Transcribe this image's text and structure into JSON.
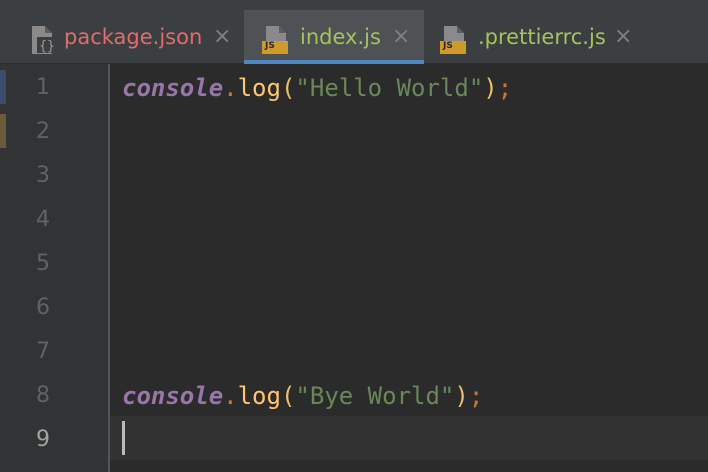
{
  "tabs": [
    {
      "label": "package.json",
      "icon": "json-file-icon",
      "label_color": "#e06c6c",
      "active": false
    },
    {
      "label": "index.js",
      "icon": "js-file-icon",
      "label_color": "#a5c25c",
      "active": true
    },
    {
      "label": ".prettierrc.js",
      "icon": "js-file-icon",
      "label_color": "#a5c25c",
      "active": false
    }
  ],
  "close_glyph": "×",
  "js_badge": "JS",
  "editor": {
    "current_line": 9,
    "line_numbers": [
      "1",
      "2",
      "3",
      "4",
      "5",
      "6",
      "7",
      "8",
      "9"
    ],
    "lines": [
      {
        "number": 1,
        "tokens": {
          "object": "console",
          "dot": ".",
          "fn": "log",
          "open": "(",
          "string": "\"Hello World\"",
          "close": ")",
          "semi": ";"
        }
      },
      {
        "number": 8,
        "tokens": {
          "object": "console",
          "dot": ".",
          "fn": "log",
          "open": "(",
          "string": "\"Bye World\"",
          "close": ")",
          "semi": ";"
        }
      }
    ]
  },
  "colors": {
    "accent_underline": "#4a88c7",
    "background": "#2b2b2b",
    "gutter": "#313335"
  }
}
